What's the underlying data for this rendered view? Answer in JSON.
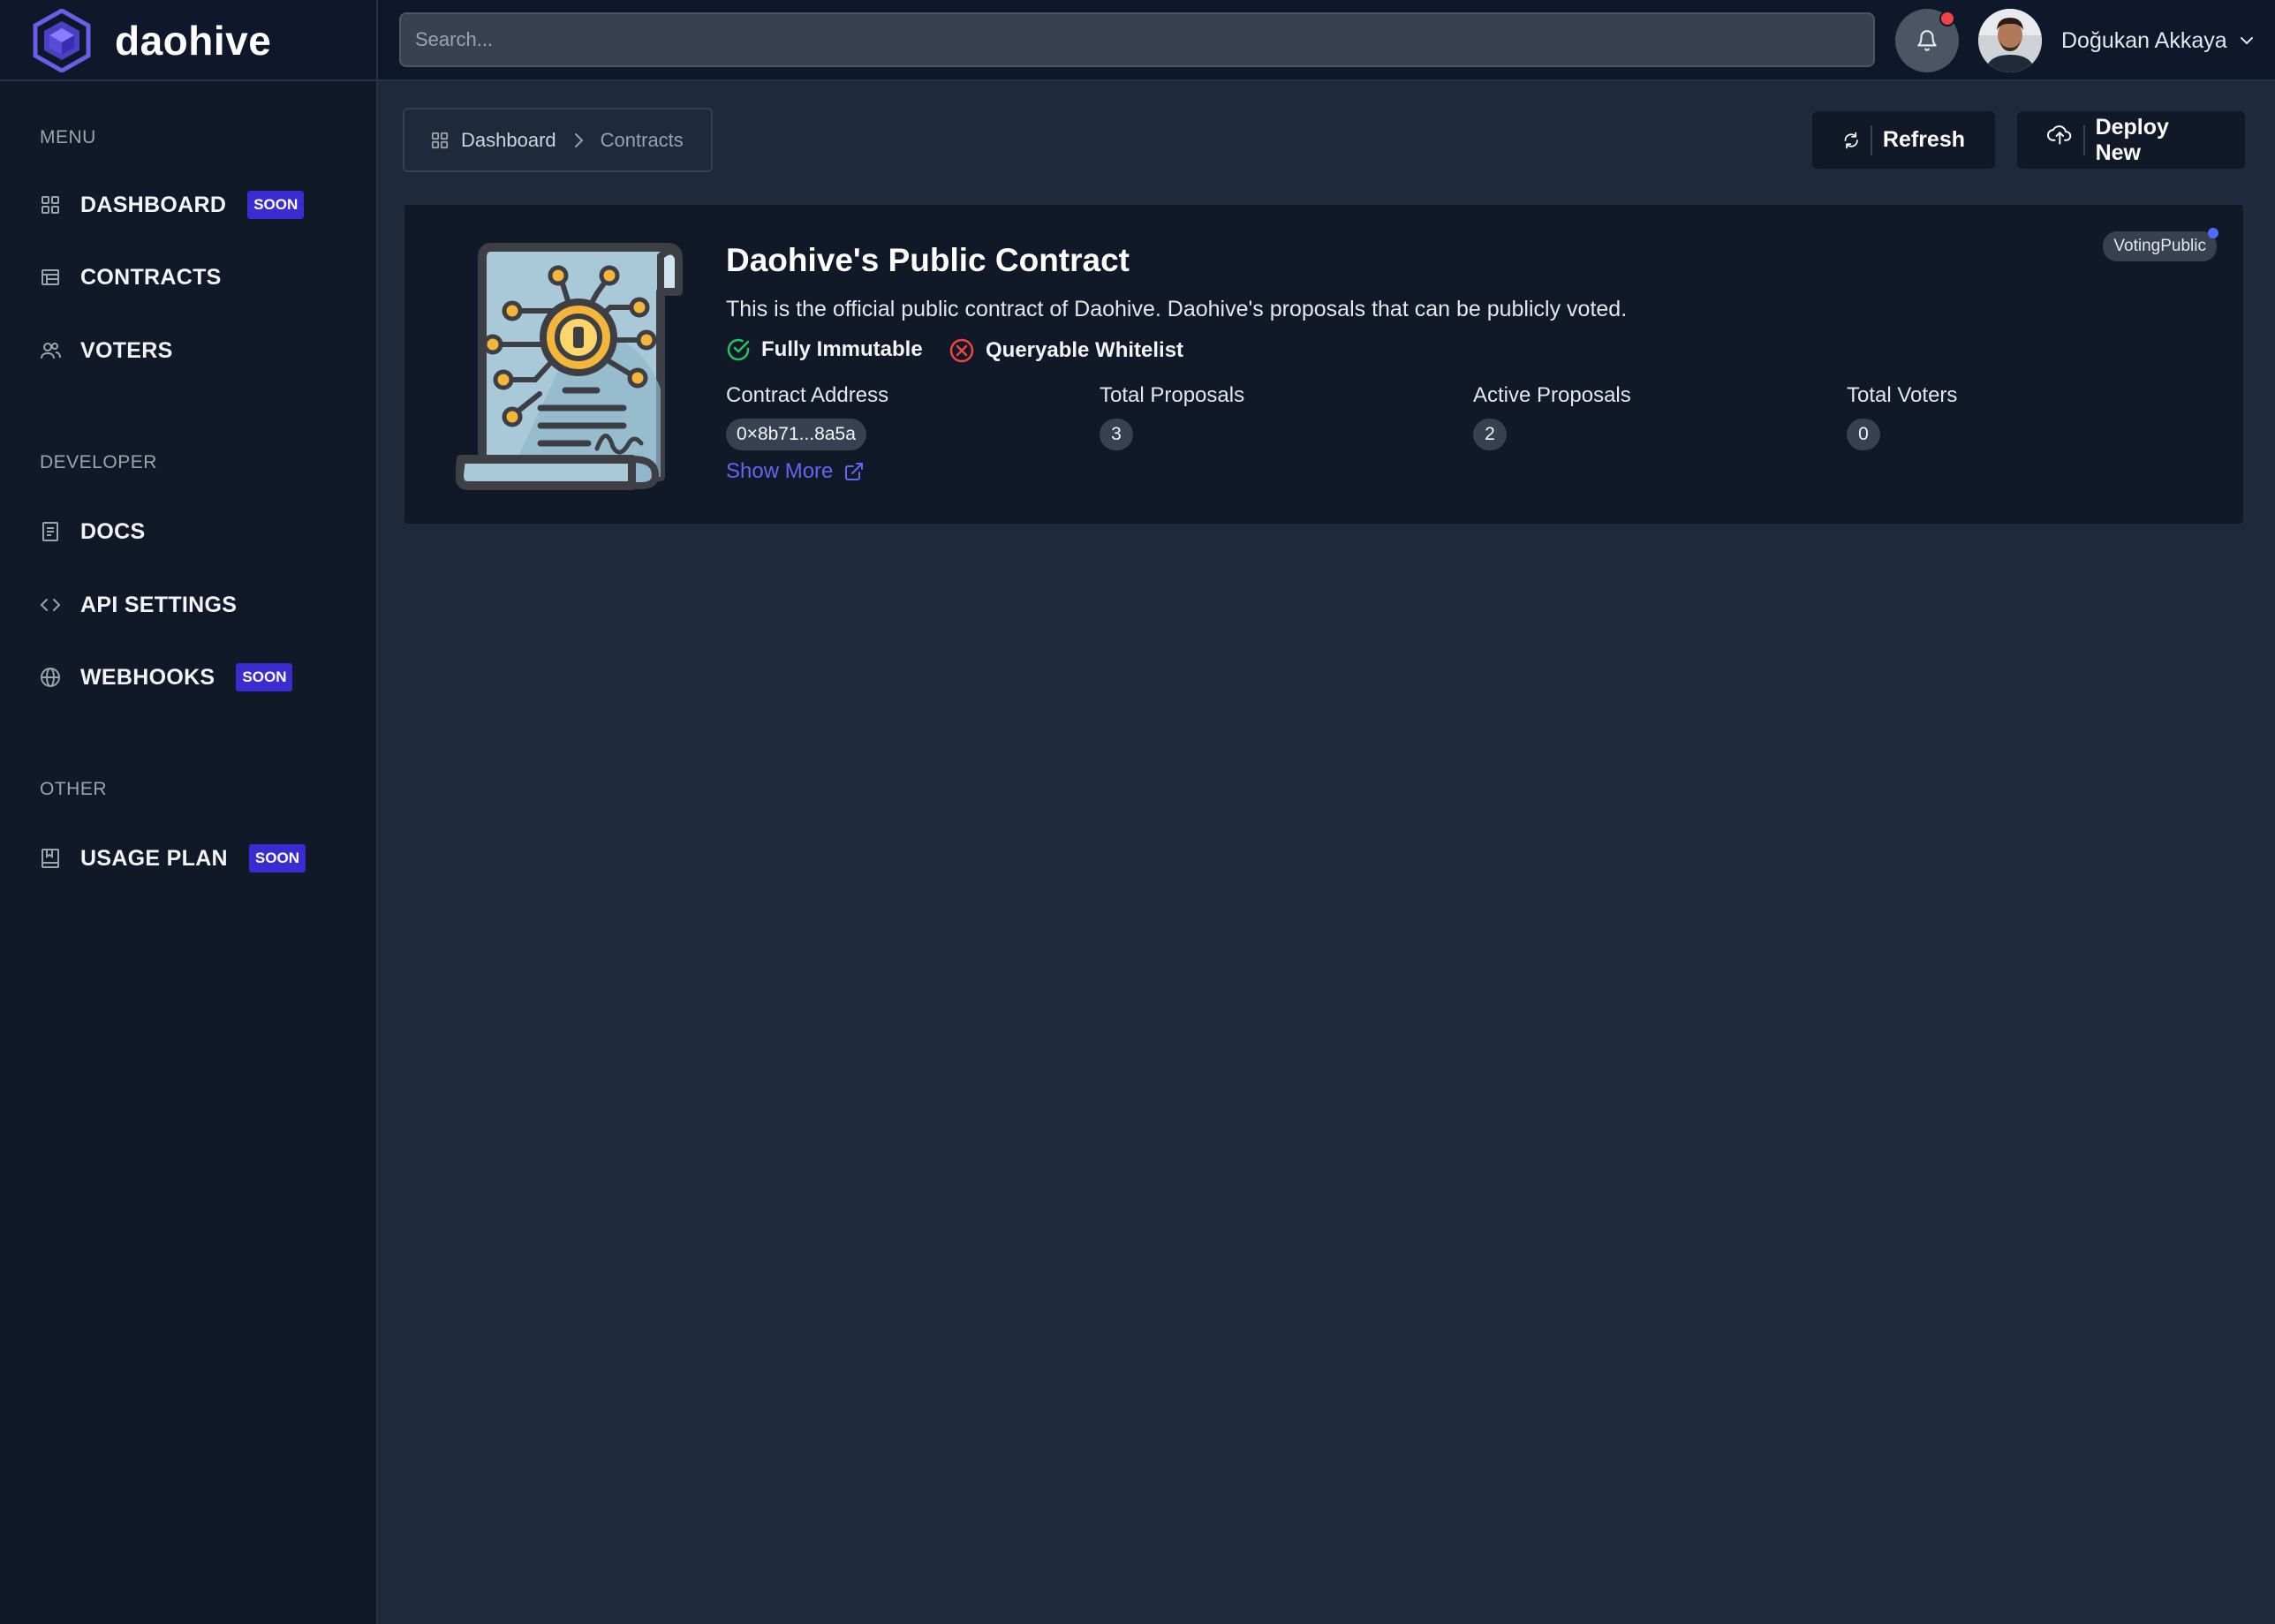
{
  "app": {
    "name": "daohive"
  },
  "header": {
    "search_placeholder": "Search...",
    "user_name": "Doğukan Akkaya"
  },
  "sidebar": {
    "sections": [
      {
        "label": "MENU",
        "items": [
          {
            "label": "DASHBOARD",
            "icon": "grid-icon",
            "badge": "SOON"
          },
          {
            "label": "CONTRACTS",
            "icon": "table-icon",
            "badge": ""
          },
          {
            "label": "VOTERS",
            "icon": "users-icon",
            "badge": ""
          }
        ]
      },
      {
        "label": "DEVELOPER",
        "items": [
          {
            "label": "DOCS",
            "icon": "document-icon",
            "badge": ""
          },
          {
            "label": "API SETTINGS",
            "icon": "code-icon",
            "badge": ""
          },
          {
            "label": "WEBHOOKS",
            "icon": "globe-icon",
            "badge": "SOON"
          }
        ]
      },
      {
        "label": "OTHER",
        "items": [
          {
            "label": "USAGE PLAN",
            "icon": "book-icon",
            "badge": "SOON"
          }
        ]
      }
    ]
  },
  "breadcrumb": {
    "root": "Dashboard",
    "current": "Contracts"
  },
  "toolbar": {
    "refresh_label": "Refresh",
    "deploy_label": "Deploy New"
  },
  "contract": {
    "title": "Daohive's Public Contract",
    "description": "This is the official public contract of Daohive. Daohive's proposals that can be publicly voted.",
    "tag": "VotingPublic",
    "features": [
      {
        "label": "Fully Immutable",
        "status": "enabled"
      },
      {
        "label": "Queryable Whitelist",
        "status": "disabled"
      }
    ],
    "stats": [
      {
        "label": "Contract Address",
        "value": "0×8b71...8a5a"
      },
      {
        "label": "Total Proposals",
        "value": "3"
      },
      {
        "label": "Active Proposals",
        "value": "2"
      },
      {
        "label": "Total Voters",
        "value": "0"
      }
    ],
    "show_more_label": "Show More"
  },
  "colors": {
    "accent": "#6366f1",
    "badge": "#3b2cd1",
    "success": "#22c55e",
    "danger": "#ef4444",
    "background": "#1e293b",
    "sidebar": "#111827"
  }
}
